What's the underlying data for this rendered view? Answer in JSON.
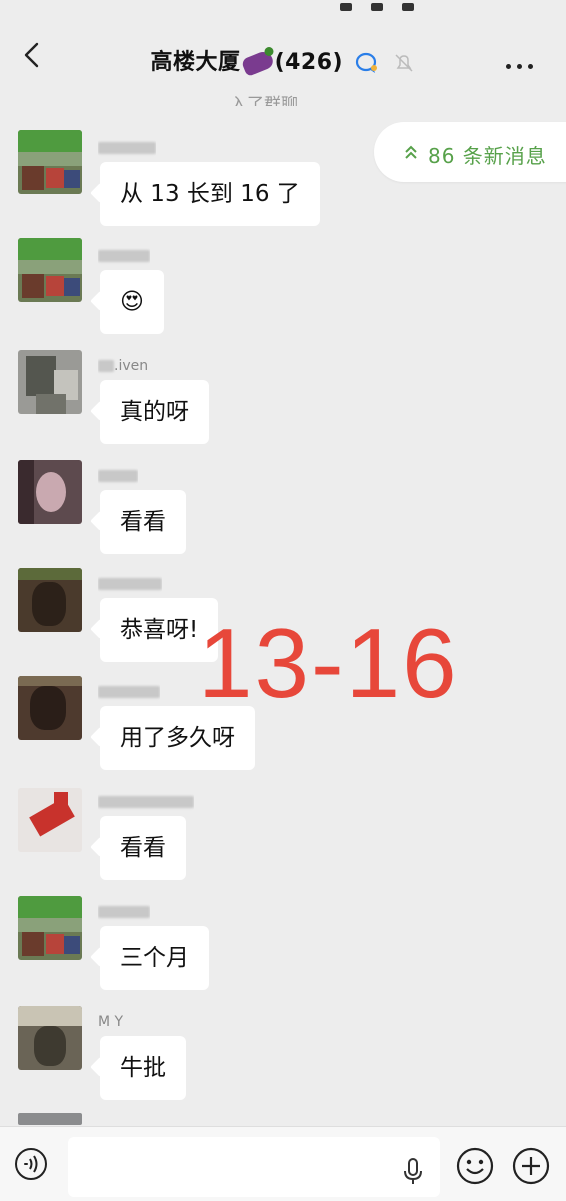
{
  "header": {
    "title_prefix": "高楼大厦",
    "member_count": "(426)",
    "join_hint": "入了群聊"
  },
  "new_messages": {
    "label": "86 条新消息"
  },
  "messages": [
    {
      "sender": "",
      "text": "从 13 长到 16 了"
    },
    {
      "sender": "",
      "text": "😍"
    },
    {
      "sender": ".iven",
      "text": "真的呀"
    },
    {
      "sender": "",
      "text": "看看"
    },
    {
      "sender": "",
      "text": "恭喜呀!"
    },
    {
      "sender": "",
      "text": "用了多久呀"
    },
    {
      "sender": "",
      "text": "看看"
    },
    {
      "sender": "",
      "text": "三个月"
    },
    {
      "sender": "M Y",
      "text": "牛批"
    }
  ],
  "overlay_text": "13-16",
  "input": {
    "placeholder": ""
  },
  "colors": {
    "background": "#ededed",
    "bubble": "#ffffff",
    "accent_green": "#57a14a",
    "overlay_red": "#e7473a"
  },
  "icons": {
    "back": "chevron-left-icon",
    "group_bubble": "chat-bubble-icon",
    "mute": "bell-off-icon",
    "more": "more-dots-icon",
    "new_msg": "double-chevron-up-icon",
    "voice": "voice-icon",
    "mic": "microphone-icon",
    "emoji": "emoji-icon",
    "plus": "plus-icon"
  }
}
